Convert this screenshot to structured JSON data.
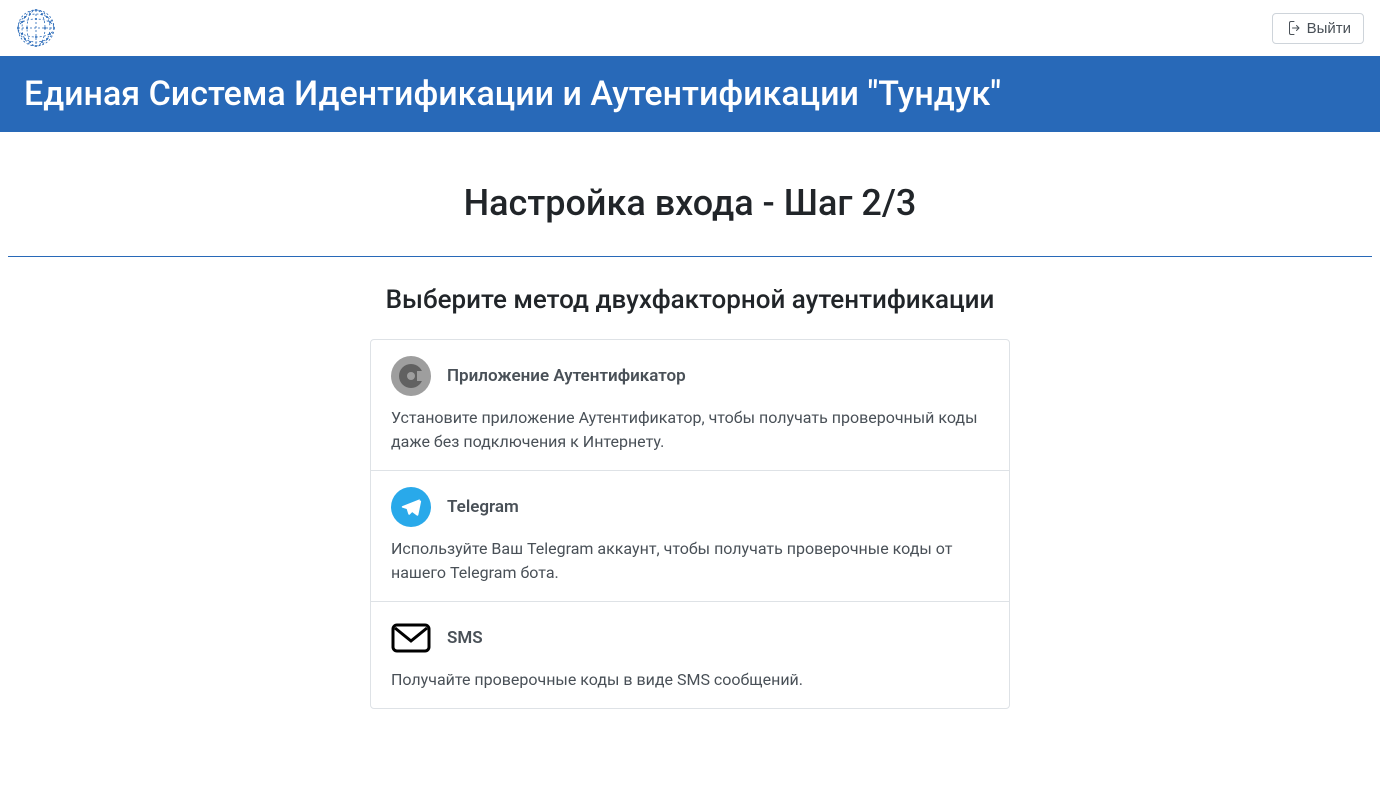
{
  "topbar": {
    "logout_label": "Выйти"
  },
  "header": {
    "title": "Единая Система Идентификации и Аутентификации \"Тундук\""
  },
  "content": {
    "step_title": "Настройка входа - Шаг 2/3",
    "subtitle": "Выберите метод двухфакторной аутентификации",
    "methods": [
      {
        "title": "Приложение Аутентификатор",
        "description": "Установите приложение Аутентификатор, чтобы получать проверочный коды даже без подключения к Интернету."
      },
      {
        "title": "Telegram",
        "description": "Используйте Ваш Telegram аккаунт, чтобы получать проверочные коды от нашего Telegram бота."
      },
      {
        "title": "SMS",
        "description": "Получайте проверочные коды в виде SMS сообщений."
      }
    ]
  }
}
